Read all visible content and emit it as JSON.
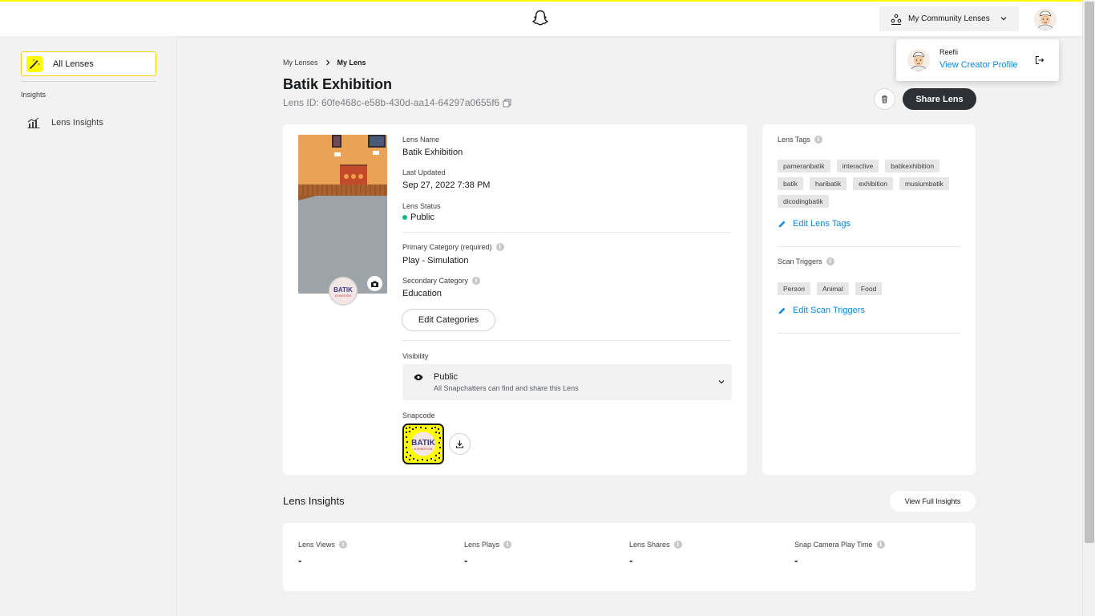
{
  "header": {
    "community_label": "My Community Lenses"
  },
  "profile_popup": {
    "name": "Reefii",
    "link": "View Creator Profile"
  },
  "sidebar": {
    "all_lenses": "All Lenses",
    "insights_section": "Insights",
    "lens_insights": "Lens Insights"
  },
  "breadcrumb": {
    "parent": "My Lenses",
    "current": "My Lens"
  },
  "lens": {
    "title": "Batik Exhibition",
    "id_text": "Lens ID: 60fe468c-e58b-430d-aa14-64297a0655f6",
    "delete_icon": "trash-icon",
    "share_label": "Share Lens",
    "preview_badge_text": "BATIK",
    "preview_badge_sub": "EXHIBITION"
  },
  "details": {
    "name_label": "Lens Name",
    "name_value": "Batik Exhibition",
    "updated_label": "Last Updated",
    "updated_value": "Sep 27, 2022 7:38 PM",
    "status_label": "Lens Status",
    "status_value": "Public",
    "status_color": "#12b886",
    "primary_label": "Primary Category (required)",
    "primary_value": "Play - Simulation",
    "secondary_label": "Secondary Category",
    "secondary_value": "Education",
    "edit_categories": "Edit Categories",
    "visibility_label": "Visibility",
    "visibility_value": "Public",
    "visibility_desc": "All Snapchatters can find and share this Lens",
    "snapcode_label": "Snapcode"
  },
  "tags_card": {
    "tags_label": "Lens Tags",
    "tags": [
      "pameranbatik",
      "interactive",
      "batikexhibition",
      "batik",
      "haribatik",
      "exhibition",
      "musiumbatik",
      "dicodingbatik"
    ],
    "edit_tags": "Edit Lens Tags",
    "triggers_label": "Scan Triggers",
    "triggers": [
      "Person",
      "Animal",
      "Food"
    ],
    "edit_triggers": "Edit Scan Triggers"
  },
  "insights": {
    "title": "Lens Insights",
    "view_full": "View Full Insights",
    "metrics": [
      {
        "label": "Lens Views",
        "value": "-"
      },
      {
        "label": "Lens Plays",
        "value": "-"
      },
      {
        "label": "Lens Shares",
        "value": "-"
      },
      {
        "label": "Snap Camera Play Time",
        "value": "-"
      }
    ]
  },
  "colors": {
    "brand_yellow": "#fffc00",
    "link_blue": "#0f87e0",
    "dark_button": "#2d3035"
  }
}
